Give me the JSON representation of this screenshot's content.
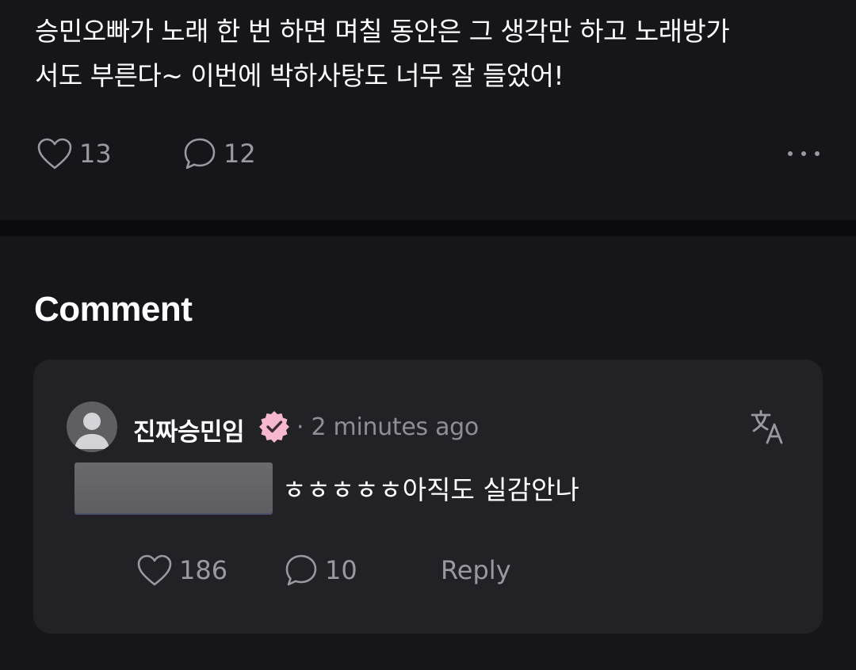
{
  "post": {
    "text_line1": "승민오빠가 노래 한 번 하면 며칠 동안은 그 생각만 하고 노래방가",
    "text_line2": "서도 부른다~ 이번에 박하사탕도 너무 잘 들었어!",
    "like_icon": "heart-outline-icon",
    "like_count": "13",
    "comment_icon": "speech-bubble-icon",
    "comment_count": "12",
    "more_icon": "more-horizontal-icon"
  },
  "comments": {
    "heading": "Comment",
    "items": [
      {
        "username": "진짜승민임",
        "verified_icon": "verified-badge-icon",
        "separator": "·",
        "time": "2 minutes ago",
        "translate_icon": "translate-icon",
        "text": "ㅎㅎㅎㅎㅎ아직도 실감안나",
        "like_count": "186",
        "reply_count": "10",
        "reply_label": "Reply"
      }
    ]
  },
  "colors": {
    "background": "#161519",
    "card": "#222126",
    "separator": "#0b0b0d",
    "text_primary": "#ffffff",
    "text_secondary": "#9a99a0",
    "verified_badge": "#f7b8cf",
    "verified_check": "#3a2a33"
  }
}
